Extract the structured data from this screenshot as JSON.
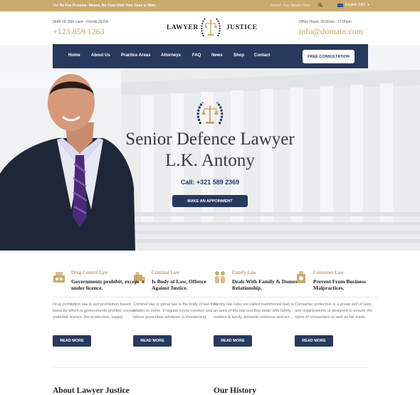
{
  "topbar": {
    "promo_lead": "Our",
    "promo_bold": "No Fee Promise:",
    "promo_rest": "Means, No Cost Until Your Case is Won.",
    "search_placeholder": "Search Your Needs Here",
    "language": "English (UK)"
  },
  "header": {
    "address": "5648 VK 26th Lane - Florida 26154.",
    "phone": "+123.859.1263",
    "logo_left": "LAWYER",
    "logo_right": "JUSTICE",
    "hours": "Office Hours: 09.00am - 17.00pm",
    "email": "info@domain.com"
  },
  "nav": {
    "items": [
      "Home",
      "About Us",
      "Practice Areas",
      "Attorneys",
      "FAQ",
      "News",
      "Shop",
      "Contact"
    ],
    "cta": "FREE CONSULTATION"
  },
  "hero": {
    "title_line1": "Senior Defence Lawyer",
    "title_line2": "L.K. Antony",
    "call": "Call: +321 589 2369",
    "button": "MAKE AN APPOINMENT"
  },
  "services": [
    {
      "icon": "drug-control-icon",
      "category": "Drug Control Law",
      "heading": "Governments prohibit, except under licence.",
      "body": "Drug prohibition law is sed prohibition based lawre by which is governments prohibit, except undertek licence, the production, supply.",
      "button": "READ MORE"
    },
    {
      "icon": "crime-van-icon",
      "category": "Criminal Law",
      "heading": "Is Body of Law, Offence Against Justice.",
      "body": "Criminal law or penal law is the body of law that relates to crime. It regulat social conduct and labour proscribes whatever is threatening.",
      "button": "READ MORE"
    },
    {
      "icon": "family-icon",
      "category": "Family Law",
      "heading": "Deals With Family & Domestic Relationship.",
      "body": "Family law (also we called matrimonial law) is an area of the law sed that deals with family matters & family domestic relations and ect...",
      "button": "READ MORE"
    },
    {
      "icon": "consumer-icon",
      "category": "Consumer Law",
      "heading": "Prevent From Business Malpractices.",
      "body": "Consumer protection is a group sed of laws and organizations ut designed to ensure the rights of consumers as well as fair trade.",
      "button": "READ MORE"
    }
  ],
  "sections": {
    "about_title": "About Lawyer Justice",
    "history_title": "Our History"
  },
  "colors": {
    "gold": "#c9aa6e",
    "navy": "#27395d"
  }
}
